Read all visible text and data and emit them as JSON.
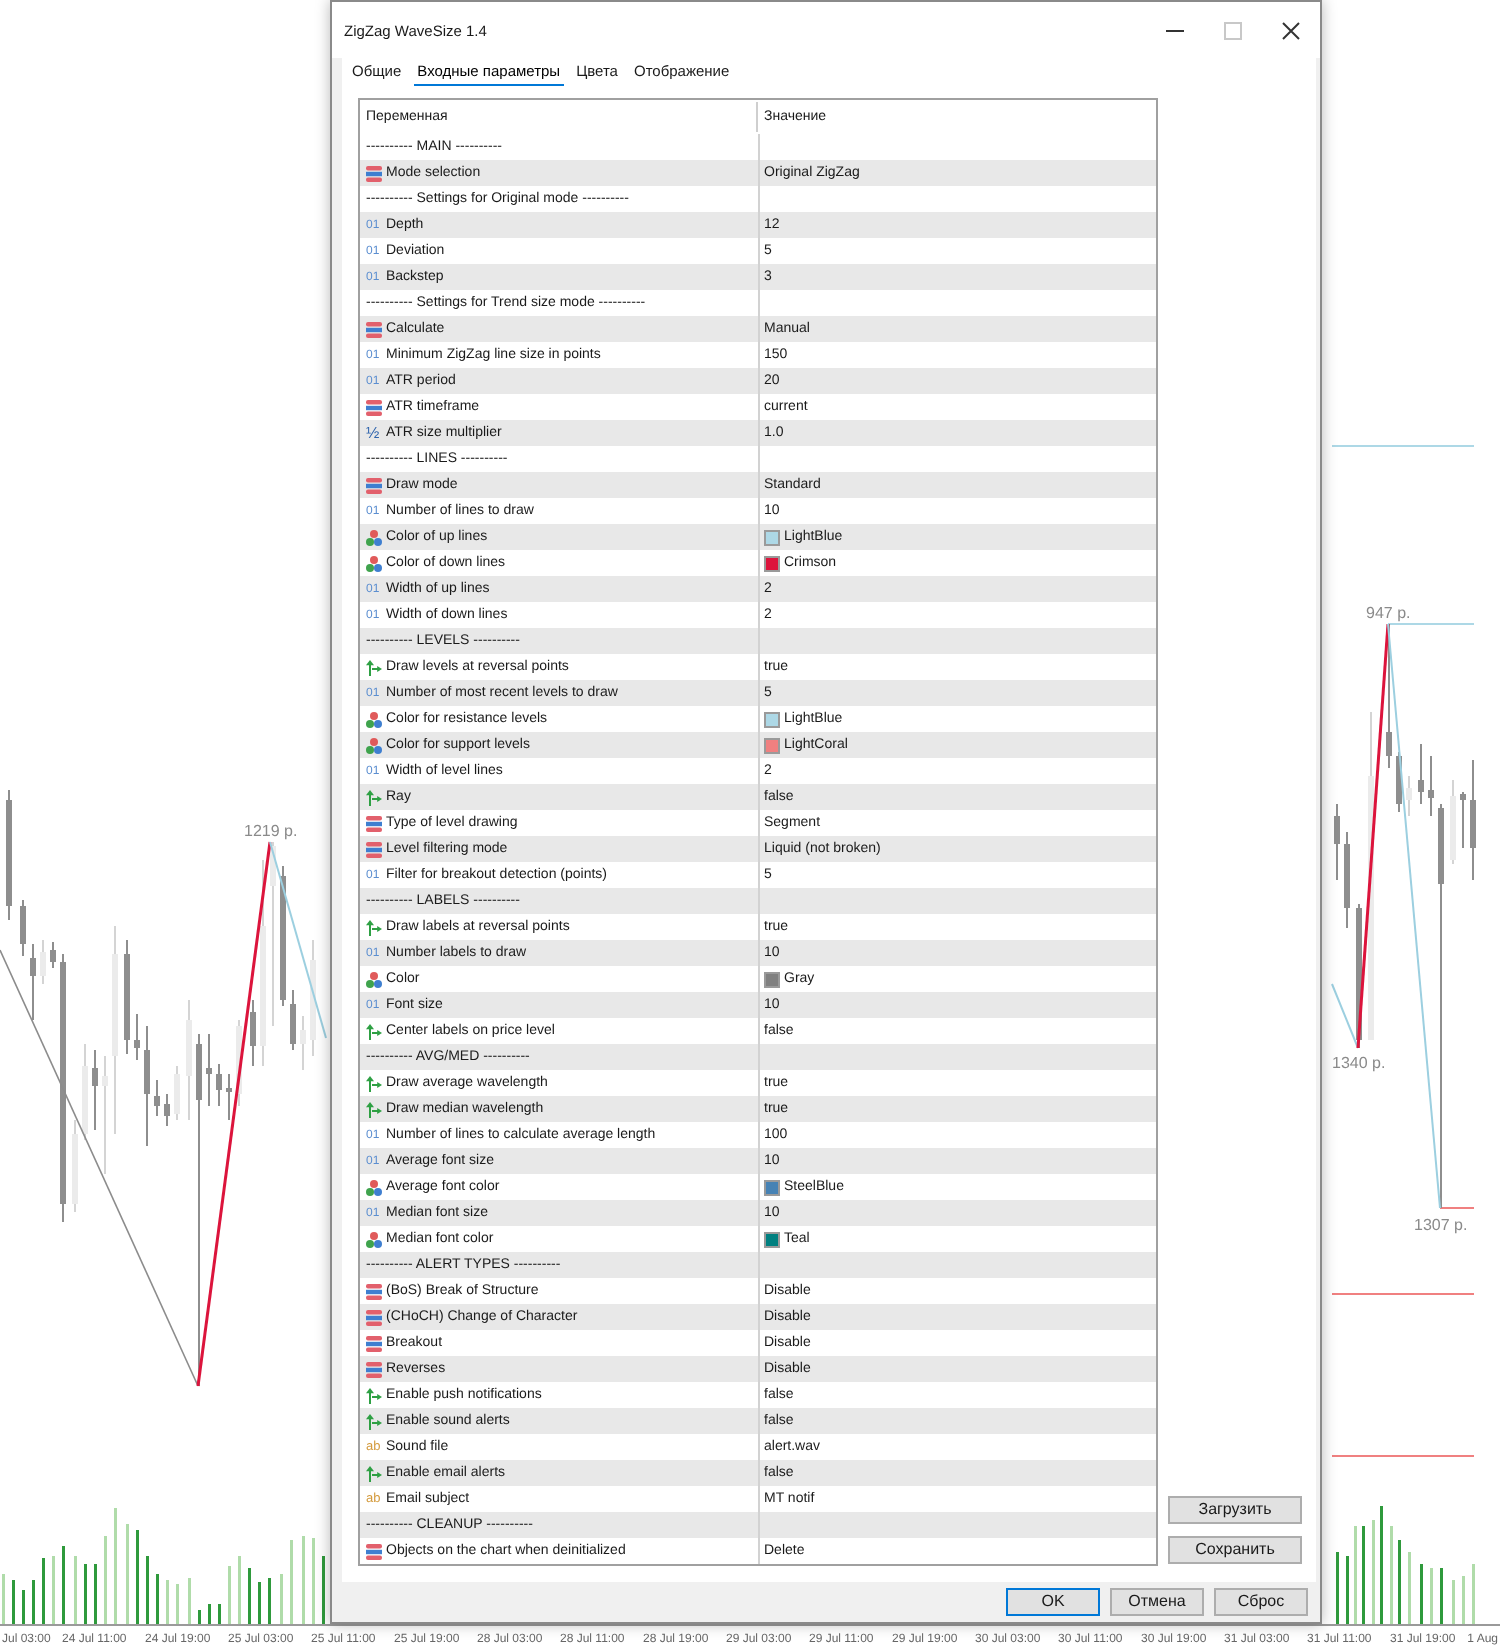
{
  "chart": {
    "wave_labels": [
      "1219 p.",
      "947 p.",
      "1340 p.",
      "1307 p."
    ],
    "time_axis": [
      "Jul 03:00",
      "24 Jul 11:00",
      "24 Jul 19:00",
      "25 Jul 03:00",
      "25 Jul 11:00",
      "25 Jul 19:00",
      "28 Jul 03:00",
      "28 Jul 11:00",
      "28 Jul 19:00",
      "29 Jul 03:00",
      "29 Jul 11:00",
      "29 Jul 19:00",
      "30 Jul 03:00",
      "30 Jul 11:00",
      "30 Jul 19:00",
      "31 Jul 03:00",
      "31 Jul 11:00",
      "31 Jul 19:00",
      "1 Aug"
    ]
  },
  "window": {
    "title": "ZigZag WaveSize 1.4",
    "controls": [
      {
        "kind": "minimize",
        "disabled": false
      },
      {
        "kind": "maximize",
        "disabled": true
      },
      {
        "kind": "close",
        "disabled": false
      }
    ]
  },
  "tabs": [
    {
      "label": "Общие",
      "selected": false
    },
    {
      "label": "Входные параметры",
      "selected": true
    },
    {
      "label": "Цвета",
      "selected": false
    },
    {
      "label": "Отображение",
      "selected": false
    }
  ],
  "table": {
    "columns": [
      "Переменная",
      "Значение"
    ],
    "rows": [
      {
        "kind": "section",
        "name": "---------- MAIN ----------"
      },
      {
        "kind": "enum",
        "name": "Mode selection",
        "value": "Original ZigZag"
      },
      {
        "kind": "section",
        "name": "---------- Settings for Original mode ----------"
      },
      {
        "kind": "int",
        "icon": "01",
        "name": "Depth",
        "value": "12"
      },
      {
        "kind": "int",
        "icon": "01",
        "name": "Deviation",
        "value": "5"
      },
      {
        "kind": "int",
        "icon": "01",
        "name": "Backstep",
        "value": "3"
      },
      {
        "kind": "section",
        "name": "---------- Settings for Trend size mode ----------"
      },
      {
        "kind": "enum",
        "name": "Calculate",
        "value": "Manual"
      },
      {
        "kind": "int",
        "icon": "01",
        "name": "Minimum ZigZag line size in points",
        "value": "150"
      },
      {
        "kind": "int",
        "icon": "01",
        "name": "ATR period",
        "value": "20"
      },
      {
        "kind": "enum",
        "name": "ATR timeframe",
        "value": "current"
      },
      {
        "kind": "double",
        "icon": "½",
        "name": "ATR size multiplier",
        "value": "1.0"
      },
      {
        "kind": "section",
        "name": "---------- LINES ----------"
      },
      {
        "kind": "enum",
        "name": "Draw mode",
        "value": "Standard"
      },
      {
        "kind": "int",
        "icon": "01",
        "name": "Number of lines to draw",
        "value": "10"
      },
      {
        "kind": "color",
        "name": "Color of up lines",
        "value": "LightBlue",
        "color": "#add8e6"
      },
      {
        "kind": "color",
        "name": "Color of down lines",
        "value": "Crimson",
        "color": "#dc143c"
      },
      {
        "kind": "int",
        "icon": "01",
        "name": "Width of up lines",
        "value": "2"
      },
      {
        "kind": "int",
        "icon": "01",
        "name": "Width of down lines",
        "value": "2"
      },
      {
        "kind": "section",
        "name": "---------- LEVELS ----------"
      },
      {
        "kind": "bool",
        "name": "Draw levels at reversal points",
        "value": "true"
      },
      {
        "kind": "int",
        "icon": "01",
        "name": "Number of most recent levels to draw",
        "value": "5"
      },
      {
        "kind": "color",
        "name": "Color for resistance levels",
        "value": "LightBlue",
        "color": "#add8e6"
      },
      {
        "kind": "color",
        "name": "Color for support levels",
        "value": "LightCoral",
        "color": "#f08080"
      },
      {
        "kind": "int",
        "icon": "01",
        "name": "Width of level lines",
        "value": "2"
      },
      {
        "kind": "bool",
        "name": "Ray",
        "value": "false"
      },
      {
        "kind": "enum",
        "name": "Type of level drawing",
        "value": "Segment"
      },
      {
        "kind": "enum",
        "name": "Level filtering mode",
        "value": "Liquid (not broken)"
      },
      {
        "kind": "int",
        "icon": "01",
        "name": "Filter for breakout detection (points)",
        "value": "5"
      },
      {
        "kind": "section",
        "name": "---------- LABELS ----------"
      },
      {
        "kind": "bool",
        "name": "Draw labels at reversal points",
        "value": "true"
      },
      {
        "kind": "int",
        "icon": "01",
        "name": "Number labels to draw",
        "value": "10"
      },
      {
        "kind": "color",
        "name": "Color",
        "value": "Gray",
        "color": "#808080"
      },
      {
        "kind": "int",
        "icon": "01",
        "name": "Font size",
        "value": "10"
      },
      {
        "kind": "bool",
        "name": "Center labels on price level",
        "value": "false"
      },
      {
        "kind": "section",
        "name": "---------- AVG/MED ----------"
      },
      {
        "kind": "bool",
        "name": "Draw average wavelength",
        "value": "true"
      },
      {
        "kind": "bool",
        "name": "Draw median wavelength",
        "value": "true"
      },
      {
        "kind": "int",
        "icon": "01",
        "name": "Number of lines to calculate average length",
        "value": "100"
      },
      {
        "kind": "int",
        "icon": "01",
        "name": "Average font size",
        "value": "10"
      },
      {
        "kind": "color",
        "name": "Average font color",
        "value": "SteelBlue",
        "color": "#4682b4"
      },
      {
        "kind": "int",
        "icon": "01",
        "name": "Median font size",
        "value": "10"
      },
      {
        "kind": "color",
        "name": "Median font color",
        "value": "Teal",
        "color": "#008080"
      },
      {
        "kind": "section",
        "name": "---------- ALERT TYPES ----------"
      },
      {
        "kind": "enum",
        "name": "(BoS) Break of Structure",
        "value": "Disable"
      },
      {
        "kind": "enum",
        "name": "(CHoCH) Change of Character",
        "value": "Disable"
      },
      {
        "kind": "enum",
        "name": "Breakout",
        "value": "Disable"
      },
      {
        "kind": "enum",
        "name": "Reverses",
        "value": "Disable"
      },
      {
        "kind": "bool",
        "name": "Enable push notifications",
        "value": "false"
      },
      {
        "kind": "bool",
        "name": "Enable sound alerts",
        "value": "false"
      },
      {
        "kind": "string",
        "icon": "ab",
        "name": "Sound file",
        "value": "alert.wav"
      },
      {
        "kind": "bool",
        "name": "Enable email alerts",
        "value": "false"
      },
      {
        "kind": "string",
        "icon": "ab",
        "name": "Email subject",
        "value": "MT notif"
      },
      {
        "kind": "section",
        "name": "---------- CLEANUP ----------"
      },
      {
        "kind": "enum",
        "name": "Objects on the chart when deinitialized",
        "value": "Delete"
      }
    ]
  },
  "side_buttons": [
    "Загрузить",
    "Сохранить"
  ],
  "buttons": [
    {
      "label": "OK",
      "default": true
    },
    {
      "label": "Отмена",
      "default": false
    },
    {
      "label": "Сброс",
      "default": false
    }
  ]
}
